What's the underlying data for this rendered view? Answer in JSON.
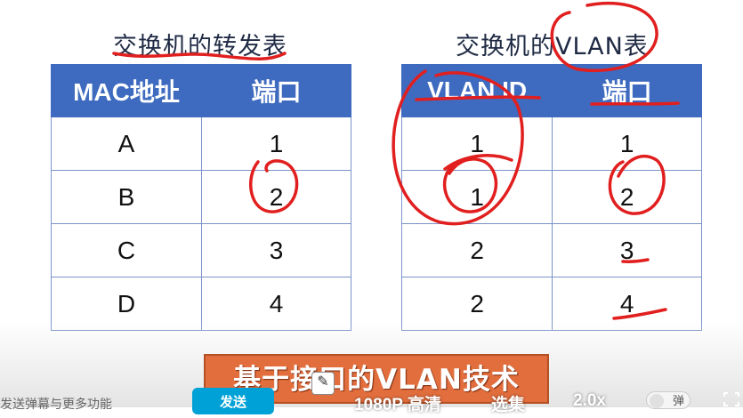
{
  "left_table": {
    "title": "交换机的转发表",
    "headers": [
      "MAC地址",
      "端口"
    ],
    "rows": [
      [
        "A",
        "1"
      ],
      [
        "B",
        "2"
      ],
      [
        "C",
        "3"
      ],
      [
        "D",
        "4"
      ]
    ]
  },
  "right_table": {
    "title": "交换机的VLAN表",
    "headers": [
      "VLAN ID",
      "端口"
    ],
    "rows": [
      [
        "1",
        "1"
      ],
      [
        "1",
        "2"
      ],
      [
        "2",
        "3"
      ],
      [
        "2",
        "4"
      ]
    ]
  },
  "banner": {
    "text": "基于接口的VLAN技术"
  },
  "player": {
    "danmaku_hint": "发送弹幕与更多功能",
    "send_label": "发送",
    "quality_label": "1080P 高清",
    "episodes_label": "选集",
    "speed_label": "2.0x",
    "danmaku_toggle_label": "弹"
  },
  "colors": {
    "header_blue": "#3e6bbf",
    "banner_orange": "#e26e3d",
    "annotation_red": "#e11f1f"
  }
}
